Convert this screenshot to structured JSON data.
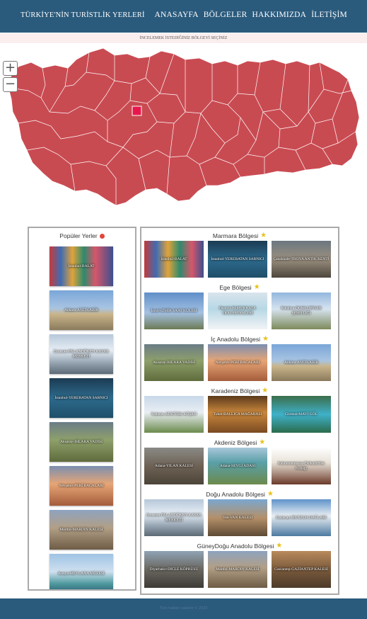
{
  "header": {
    "site_title": "TÜRKİYE'NİN TURİSTLİK YERLERİ",
    "nav": [
      "ANASAYFA",
      "BÖLGELER",
      "HAKKIMIZDA",
      "İLETİŞİM"
    ]
  },
  "map": {
    "instruction": "İNCELEMEK İSTEDİĞİNİZ BÖLGEYİ SEÇİNİZ",
    "zoom_in": "+",
    "zoom_out": "−",
    "fill_color": "#c94b52",
    "highlight_color": "#e8174b"
  },
  "popular": {
    "title": "Popüler Yerler",
    "icon": "flame-icon",
    "items": [
      "İstanbul-BALAT",
      "Ankara-ANITKABİR",
      "Erzurum-PALANDÖKEN KAYAK MERKEZİ",
      "İstanbul-YEREBATAN SARNICI",
      "Aksaray-IHLARA VADİSİ",
      "Nevşehir-PERİ BACALARI",
      "Mardin-MARDİN KALESİ",
      "Konya-MEVLANA MÜZESİ"
    ]
  },
  "regions": [
    {
      "name": "Marmara Bölgesi",
      "places": [
        "İstanbul-BALAT",
        "İstanbul-YEREBATAN SARNICI",
        "Çanakkale-TROYA ANTİK KENTİ"
      ]
    },
    {
      "name": "Ege Bölgesi",
      "places": [
        "İzmir-İZMİR SAAT KULESİ",
        "Denizli-PAMUKKALE TRAVERTENLERİ",
        "Kütahya-DUMLUPINAR ŞEHİTLİĞİ"
      ]
    },
    {
      "name": "İç Anadolu Bölgesi",
      "places": [
        "Aksaray-IHLARA VADİSİ",
        "Nevşehir-PERİ BACALARI",
        "Ankara-ANITKABİR"
      ]
    },
    {
      "name": "Karadeniz Bölgesi",
      "places": [
        "Trabzon-ATATÜRK KÖŞKÜ",
        "Tokat-BALLICA MAĞARASI",
        "Giresun-MAVİ GÖL"
      ]
    },
    {
      "name": "Akdeniz Bölgesi",
      "places": [
        "Adana-YILAN KALESİ",
        "Adana-SEVGİ ADASI",
        "Kahramanmaraş-Dulkadirliler Konağı"
      ]
    },
    {
      "name": "Doğu Anadolu Bölgesi",
      "places": [
        "Erzurum-PALANDÖKEN KAYAK MERKEZİ",
        "Van-VAN KALESİ",
        "Erzincan-MUNZUR DAĞLARI"
      ]
    },
    {
      "name": "GüneyDoğu Anadolu Bölgesi",
      "places": [
        "Diyarbakır-DİCLE KÖPRÜSÜ",
        "Mardin-MARDİN KALESİ",
        "Gaziantep-GAZİANTEP KALESİ"
      ]
    }
  ],
  "footer": {
    "text": "Tüm hakları saklıdır © 2023"
  },
  "colors": {
    "header_bg": "#2a5a7c",
    "star": "#e8c21a",
    "flame": "#e4453a"
  }
}
